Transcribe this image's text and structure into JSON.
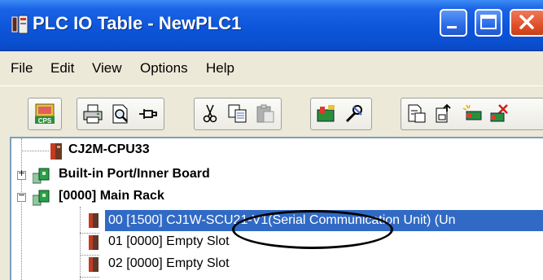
{
  "window": {
    "title": "PLC IO Table - NewPLC1"
  },
  "menubar": {
    "items": [
      "File",
      "Edit",
      "View",
      "Options",
      "Help"
    ]
  },
  "toolbar": {
    "buttons": [
      {
        "name": "cps-icon"
      },
      {
        "name": "print-icon"
      },
      {
        "name": "print-preview-icon"
      },
      {
        "name": "pin-icon"
      },
      {
        "name": "cut-icon"
      },
      {
        "name": "copy-icon"
      },
      {
        "name": "paste-icon"
      },
      {
        "name": "transfer-icon"
      },
      {
        "name": "tools-icon"
      },
      {
        "name": "compare-icon"
      },
      {
        "name": "upload-icon"
      },
      {
        "name": "new-unit-icon"
      },
      {
        "name": "delete-icon"
      }
    ],
    "cps_label": "CPS"
  },
  "tree": {
    "cpu": "CJ2M-CPU33",
    "builtin": "Built-in Port/Inner Board",
    "builtin_expander": "+",
    "main_rack": "[0000] Main Rack",
    "main_rack_expander": "−",
    "slots": [
      {
        "label": "00 [1500] CJ1W-SCU21-V1(Serial Communication Unit) (Un"
      },
      {
        "label": "01 [0000] Empty Slot"
      },
      {
        "label": "02 [0000] Empty Slot"
      }
    ]
  },
  "colors": {
    "titlebar": "#0a4fd0",
    "selection": "#316ac5",
    "close_button": "#e0502a"
  }
}
